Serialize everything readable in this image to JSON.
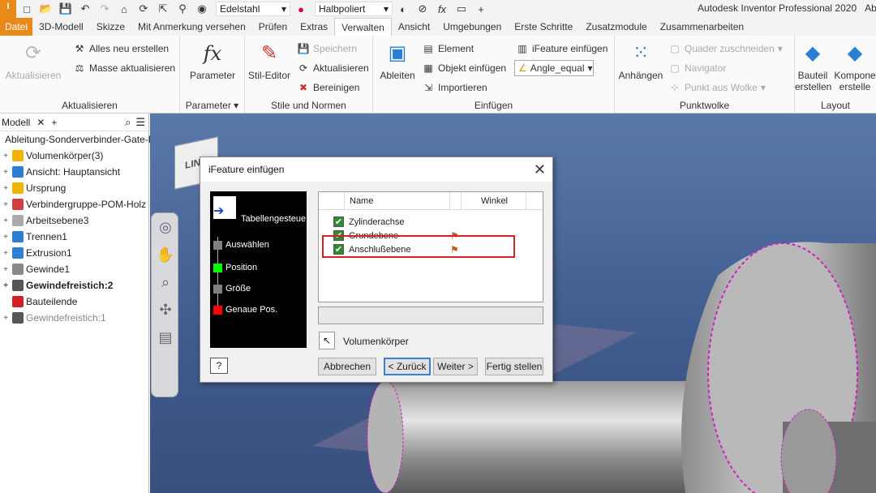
{
  "app_title": "Autodesk Inventor Professional 2020",
  "app_title_tail": "Abl",
  "qat": {
    "logo": "I",
    "material": "Edelstahl",
    "appearance": "Halbpoliert"
  },
  "tabs": [
    "Datei",
    "3D-Modell",
    "Skizze",
    "Mit Anmerkung versehen",
    "Prüfen",
    "Extras",
    "Verwalten",
    "Ansicht",
    "Umgebungen",
    "Erste Schritte",
    "Zusatzmodule",
    "Zusammenarbeiten"
  ],
  "active_tab": "Verwalten",
  "ribbon": {
    "aktualisieren": {
      "label": "Aktualisieren",
      "big": "Aktualisieren",
      "small1": "Alles neu erstellen",
      "small2": "Masse aktualisieren"
    },
    "parameter": {
      "label": "Parameter ▾",
      "big": "Parameter"
    },
    "stile": {
      "label": "Stile und Normen",
      "big": "Stil-Editor",
      "small1": "Speichern",
      "small2": "Aktualisieren",
      "small3": "Bereinigen"
    },
    "einfuegen": {
      "label": "Einfügen",
      "big": "Ableiten",
      "small1": "Element",
      "small2": "Objekt einfügen",
      "small3": "Importieren",
      "small4": "iFeature einfügen",
      "dropdown": "Angle_equal"
    },
    "punktwolke": {
      "label": "Punktwolke",
      "big": "Anhängen",
      "small1": "Quader zuschneiden",
      "small2": "Navigator",
      "small3": "Punkt aus Wolke"
    },
    "layout": {
      "label": "Layout",
      "big1a": "Bauteil",
      "big1b": "erstellen",
      "big2a": "Kompone",
      "big2b": "erstelle"
    }
  },
  "browser": {
    "tab": "Modell",
    "items": [
      {
        "label": "Ableitung-Sonderverbinder-Gate-F",
        "bold": false,
        "dim": false
      },
      {
        "label": "Volumenkörper(3)",
        "bold": false,
        "dim": false
      },
      {
        "label": "Ansicht: Hauptansicht",
        "bold": false,
        "dim": false
      },
      {
        "label": "Ursprung",
        "bold": false,
        "dim": false
      },
      {
        "label": "Verbindergruppe-POM-Holz",
        "bold": false,
        "dim": false
      },
      {
        "label": "Arbeitsebene3",
        "bold": false,
        "dim": false
      },
      {
        "label": "Trennen1",
        "bold": false,
        "dim": false
      },
      {
        "label": "Extrusion1",
        "bold": false,
        "dim": false
      },
      {
        "label": "Gewinde1",
        "bold": false,
        "dim": false
      },
      {
        "label": "Gewindefreistich:2",
        "bold": true,
        "dim": false
      },
      {
        "label": "Bauteilende",
        "bold": false,
        "dim": false
      },
      {
        "label": "Gewindefreistich:1",
        "bold": false,
        "dim": true
      }
    ]
  },
  "viewcube_label": "LINK",
  "dialog": {
    "title": "iFeature einfügen",
    "steps_title": "Tabellengesteue",
    "steps": [
      {
        "label": "Auswählen",
        "color": "#808080"
      },
      {
        "label": "Position",
        "color": "#00ff00"
      },
      {
        "label": "Größe",
        "color": "#808080"
      },
      {
        "label": "Genaue Pos.",
        "color": "#ff0000"
      }
    ],
    "col_name": "Name",
    "col_winkel": "Winkel",
    "rows": [
      "Zylinderachse",
      "Grundebene",
      "Anschlußebene"
    ],
    "select_label": "Volumenkörper",
    "buttons": {
      "cancel": "Abbrechen",
      "back": "< Zurück",
      "next": "Weiter >",
      "finish": "Fertig stellen"
    }
  }
}
